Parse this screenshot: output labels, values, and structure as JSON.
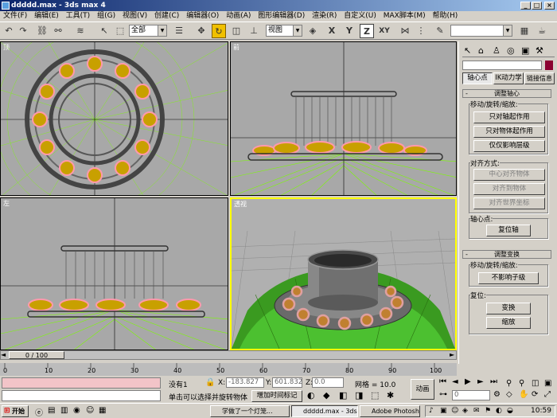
{
  "window": {
    "title": "ddddd.max - 3ds max 4"
  },
  "menu": [
    "文件(F)",
    "编辑(E)",
    "工具(T)",
    "组(G)",
    "视图(V)",
    "创建(C)",
    "编辑器(O)",
    "动画(A)",
    "图形编辑器(D)",
    "渲染(R)",
    "自定义(U)",
    "MAX脚本(M)",
    "帮助(H)"
  ],
  "toolbar": {
    "selection_filter": "全部",
    "ref_coord": "视图",
    "axes": [
      "X",
      "Y",
      "Z",
      "XY"
    ],
    "named_sel": ""
  },
  "viewports": {
    "top": "顶",
    "front": "前",
    "left": "左",
    "perspective": "透视"
  },
  "command_panel": {
    "tabs": [
      "轴心点",
      "IK动力学",
      "链接信息"
    ],
    "pivot_rollout": "调整轴心",
    "move_rotate_scale": "移动/旋转/缩放:",
    "affect_pivot_only": "只对轴起作用",
    "affect_object_only": "只对物体起作用",
    "affect_hierarchy_only": "仅仅影响层级",
    "alignment": "对齐方式:",
    "center_to_object": "中心对齐物体",
    "align_to_object": "对齐到物体",
    "align_to_world": "对齐世界坐标",
    "pivot_label": "轴心点:",
    "reset_pivot": "复位轴",
    "transform_rollout": "调整变换",
    "move_rotate_scale2": "移动/旋转/缩放:",
    "dont_affect_children": "不影响子级",
    "reset_label": "复位:",
    "transform_btn": "变换",
    "scale_btn": "缩放"
  },
  "timeline": {
    "frame": "0 / 100",
    "ticks": [
      "0",
      "10",
      "20",
      "30",
      "40",
      "50",
      "60",
      "70",
      "80",
      "90",
      "100"
    ]
  },
  "status": {
    "selection": "没有1",
    "x_label": "X:",
    "x_value": "-183.827",
    "y_label": "Y:",
    "y_value": "601.832",
    "z_label": "Z:",
    "z_value": "0.0",
    "grid_label": "网格 = 10.0",
    "animate": "动画",
    "prompt": "单击可以选择并旋转物体",
    "add_time_tag": "增加时间标记",
    "frame_field": "0"
  },
  "taskbar": {
    "start": "开始",
    "tasks": [
      "学做了一个灯笼...",
      "ddddd.max - 3ds ...",
      "Adobe Photoshop"
    ],
    "clock": "10:59"
  },
  "colors": {
    "active_viewport": "#ffff00",
    "title_bar": "#0a246a",
    "panel": "#d4d0c8"
  }
}
